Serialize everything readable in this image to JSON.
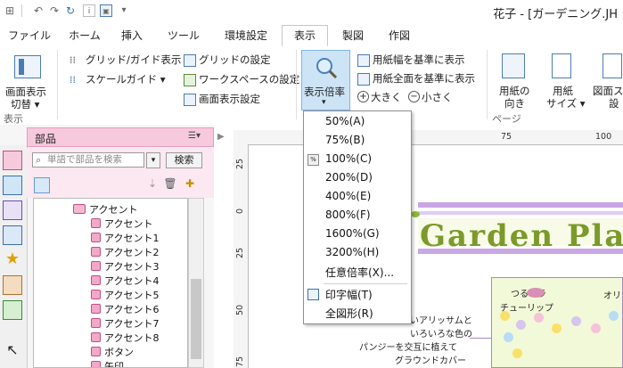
{
  "window": {
    "title": "花子 - [ガーデニング.JH"
  },
  "tabs": [
    {
      "label": "ファイル"
    },
    {
      "label": "ホーム"
    },
    {
      "label": "挿入"
    },
    {
      "label": "ツール"
    },
    {
      "label": "環境設定"
    },
    {
      "label": "表示"
    },
    {
      "label": "製図"
    },
    {
      "label": "作図"
    }
  ],
  "ribbon": {
    "screen_switch": "画面表示",
    "screen_switch2": "切替 ▾",
    "grid_guide": "グリッド/ガイド表示 ▾",
    "scale_guide": "スケールガイド ▾",
    "grid_settings": "グリッドの設定",
    "workspace_settings": "ワークスペースの設定",
    "screen_settings": "画面表示設定",
    "zoom": "表示倍率",
    "paper_width": "用紙幅を基準に表示",
    "paper_full": "用紙全面を基準に表示",
    "larger": "大きく",
    "smaller": "小さく",
    "paper_orient": "用紙の",
    "paper_orient2": "向き",
    "paper_size": "用紙",
    "paper_size2": "サイズ ▾",
    "figure_screen": "図面ス",
    "figure_screen2": "設",
    "group_display": "表示",
    "group_page": "ページ"
  },
  "zoom_menu": {
    "items": [
      "50%(A)",
      "75%(B)",
      "100%(C)",
      "200%(D)",
      "400%(E)",
      "800%(F)",
      "1600%(G)",
      "3200%(H)",
      "任意倍率(X)..."
    ],
    "print_width": "印字幅(T)",
    "full_figure": "全図形(R)"
  },
  "panel": {
    "title": "部品",
    "search_placeholder": "単語で部品を検索",
    "search_button": "検索",
    "tree": [
      {
        "label": "アクセント",
        "level": 0
      },
      {
        "label": "アクセント",
        "level": 1
      },
      {
        "label": "アクセント1",
        "level": 1
      },
      {
        "label": "アクセント2",
        "level": 1
      },
      {
        "label": "アクセント3",
        "level": 1
      },
      {
        "label": "アクセント4",
        "level": 1
      },
      {
        "label": "アクセント5",
        "level": 1
      },
      {
        "label": "アクセント6",
        "level": 1
      },
      {
        "label": "アクセント7",
        "level": 1
      },
      {
        "label": "アクセント8",
        "level": 1
      },
      {
        "label": "ボタン",
        "level": 1
      },
      {
        "label": "矢印",
        "level": 1
      }
    ]
  },
  "rulers": {
    "top": [
      "75",
      "100"
    ],
    "left": [
      "25",
      "0",
      "25",
      "50",
      "75"
    ]
  },
  "canvas": {
    "heading": "Garden Pla",
    "text_lines": [
      "いアリッサムと",
      "いろいろな色の",
      "パンジーを交互に植えて",
      "グラウンドカバー"
    ],
    "label_tsurubara": "つるバラ",
    "label_tulip": "チューリップ",
    "label_oli": "オリ"
  },
  "colors": {
    "accent": "#7eb4ea",
    "panel_pink": "#f7c9dd",
    "garden_green": "#7b9a2a",
    "stripe_purple": "#c9a6e6"
  }
}
